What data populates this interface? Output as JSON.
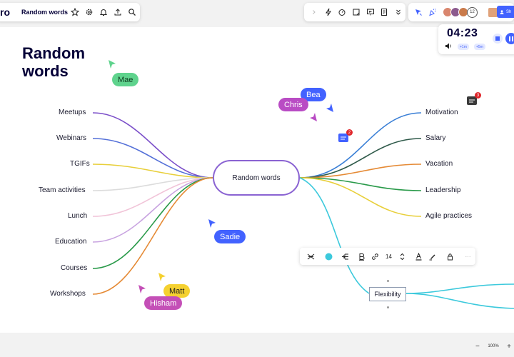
{
  "toolbar": {
    "logo_text": "ro",
    "board_title": "Random words"
  },
  "collaborators": {
    "count": "12",
    "share_label": "Sh"
  },
  "timer": {
    "value": "04:23",
    "add_1m": "+1m",
    "add_5m": "+5m"
  },
  "headline": "Random words",
  "mindmap": {
    "center": "Random words",
    "left_branches": [
      "Meetups",
      "Webinars",
      "TGIFs",
      "Team activities",
      "Lunch",
      "Education",
      "Courses",
      "Workshops"
    ],
    "right_branches": [
      "Motivation",
      "Salary",
      "Vacation",
      "Leadership",
      "Agile practices"
    ],
    "selected_child": "Flexibility",
    "left_colors": [
      "#7b4fc9",
      "#5470d8",
      "#e8cf3a",
      "#dcdcdc",
      "#f1c4d8",
      "#c8a3e0",
      "#2a9a4a",
      "#e58a35"
    ],
    "right_colors": [
      "#3a7fd6",
      "#2f5a4a",
      "#e58a35",
      "#2a9a4a",
      "#e8cf3a"
    ],
    "flex_color": "#3cc9dc"
  },
  "cursors": [
    {
      "name": "Mae",
      "color": "#5fd38d"
    },
    {
      "name": "Bea",
      "color": "#4262ff"
    },
    {
      "name": "Chris",
      "color": "#b94cc4"
    },
    {
      "name": "Sadie",
      "color": "#4262ff"
    },
    {
      "name": "Matt",
      "color": "#f5d130"
    },
    {
      "name": "Hisham",
      "color": "#c44fb7"
    }
  ],
  "comments": [
    {
      "count": "3",
      "color": "#3a3a3a"
    },
    {
      "count": "2",
      "color": "#4262ff"
    }
  ],
  "format_bar": {
    "font_size": "14",
    "more": "···"
  },
  "zoom": {
    "minus": "−",
    "level": "100%",
    "plus": "+"
  }
}
